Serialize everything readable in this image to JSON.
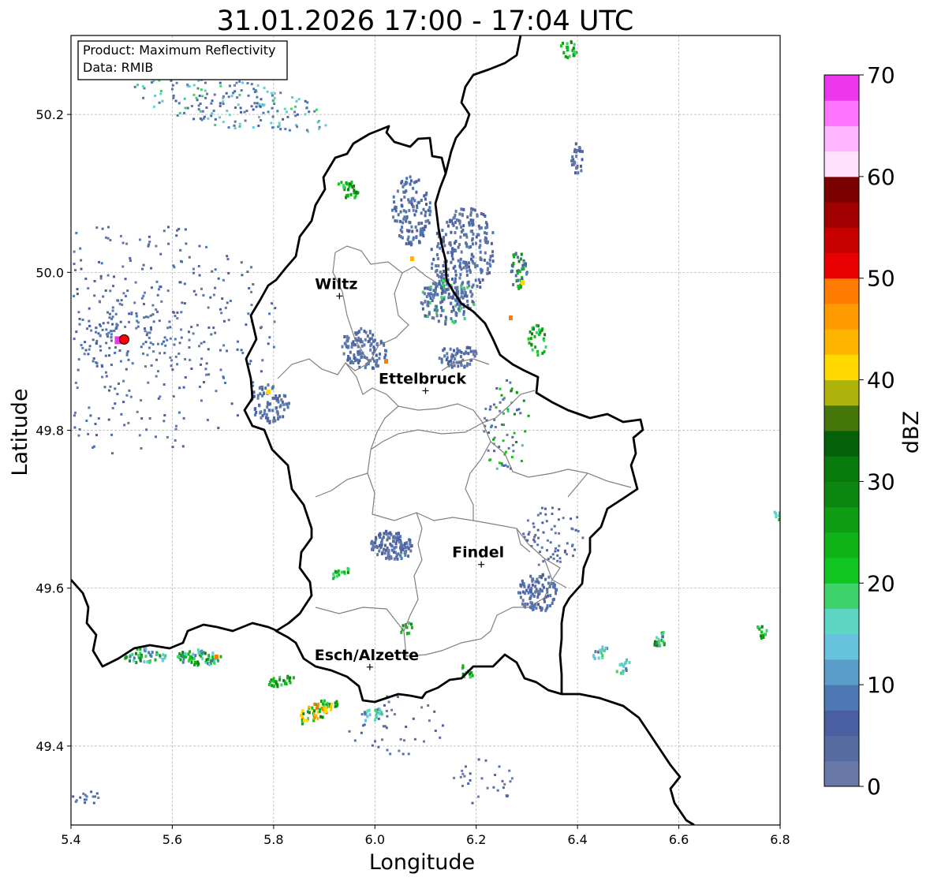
{
  "title": "31.01.2026 17:00 - 17:04 UTC",
  "info_box": {
    "product_line": "Product: Maximum Reflectivity",
    "data_line": "Data: RMIB"
  },
  "x_axis": {
    "label": "Longitude",
    "range": [
      5.4,
      6.8
    ],
    "ticks": [
      "5.4",
      "5.6",
      "5.8",
      "6.0",
      "6.2",
      "6.4",
      "6.6",
      "6.8"
    ]
  },
  "y_axis": {
    "label": "Latitude",
    "range": [
      49.3,
      50.3
    ],
    "ticks": [
      "49.4",
      "49.6",
      "49.8",
      "50.0",
      "50.2"
    ]
  },
  "grid": true,
  "colorbar": {
    "label": "dBZ",
    "range": [
      0,
      70
    ],
    "ticks": [
      "0",
      "10",
      "20",
      "30",
      "40",
      "50",
      "60",
      "70"
    ],
    "colors": [
      "#6879a8",
      "#566ba0",
      "#4a5fa2",
      "#4d78b3",
      "#5a9dca",
      "#67c2de",
      "#5dd6c4",
      "#3dd26a",
      "#12c41f",
      "#11b418",
      "#0f9e13",
      "#0b8710",
      "#087a0c",
      "#05600a",
      "#457609",
      "#afb20a",
      "#ffd900",
      "#ffb400",
      "#ff9b00",
      "#ff7c00",
      "#e90000",
      "#c90000",
      "#a10000",
      "#7b0000",
      "#ffe0ff",
      "#ffb5ff",
      "#ff75ff",
      "#ec36ec"
    ]
  },
  "places": [
    {
      "name": "Wiltz",
      "lon": 5.93,
      "lat": 49.97
    },
    {
      "name": "Ettelbruck",
      "lon": 6.1,
      "lat": 49.85
    },
    {
      "name": "Findel",
      "lon": 6.21,
      "lat": 49.63
    },
    {
      "name": "Esch/Alzette",
      "lon": 5.99,
      "lat": 49.5
    }
  ],
  "radar_site": {
    "lon": 5.505,
    "lat": 49.915,
    "color": "#ff0000"
  },
  "colors": {
    "border": "#000000",
    "canton": "#808080",
    "gridline": "#b0b0b0"
  }
}
